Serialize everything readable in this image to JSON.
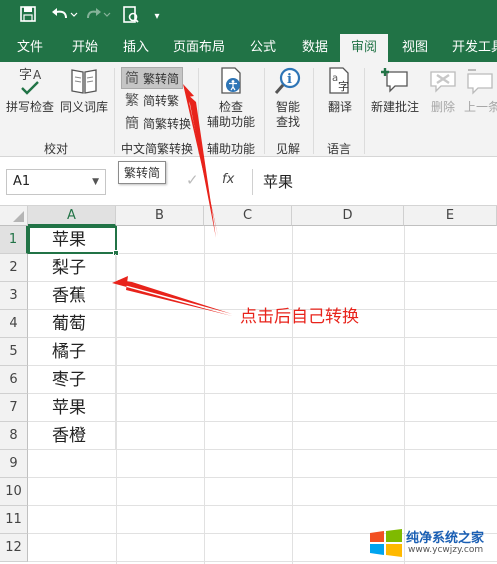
{
  "qat": {
    "save_icon": "save-icon",
    "undo_icon": "undo-icon",
    "redo_icon": "redo-icon",
    "print_preview_icon": "print-preview-icon",
    "customize_icon": "customize-qat-icon"
  },
  "tabs": [
    {
      "label": "文件"
    },
    {
      "label": "开始"
    },
    {
      "label": "插入"
    },
    {
      "label": "页面布局"
    },
    {
      "label": "公式"
    },
    {
      "label": "数据"
    },
    {
      "label": "审阅"
    },
    {
      "label": "视图"
    },
    {
      "label": "开发工具"
    }
  ],
  "ribbon": {
    "spelling": "拼写检查",
    "thesaurus": "同义词库",
    "proofing_group": "校对",
    "to_simplified": "繁转简",
    "to_traditional": "简转繁",
    "convert": "简繁转换",
    "chinese_group": "中文简繁转换",
    "check_accessibility": [
      "检查",
      "辅助功能"
    ],
    "accessibility_group": "辅助功能",
    "smart_lookup": [
      "智能",
      "查找"
    ],
    "insights_group": "见解",
    "translate": "翻译",
    "language_group": "语言",
    "new_comment": "新建批注",
    "delete": "删除",
    "previous": "上一条"
  },
  "tooltip": "繁转简",
  "formula_bar": {
    "name_box": "A1",
    "fx": "fx",
    "value": "苹果"
  },
  "columns": [
    "A",
    "B",
    "C",
    "D",
    "E"
  ],
  "rows": [
    "1",
    "2",
    "3",
    "4",
    "5",
    "6",
    "7",
    "8",
    "9",
    "10",
    "11",
    "12"
  ],
  "cells": [
    "苹果",
    "梨子",
    "香蕉",
    "葡萄",
    "橘子",
    "枣子",
    "苹果",
    "香橙"
  ],
  "annotation": "点击后自己转换",
  "colors": {
    "excel_green": "#217346",
    "arrow_red": "#e8231b"
  },
  "watermark": {
    "title": "纯净系统之家",
    "url": "www.ycwjzy.com"
  }
}
